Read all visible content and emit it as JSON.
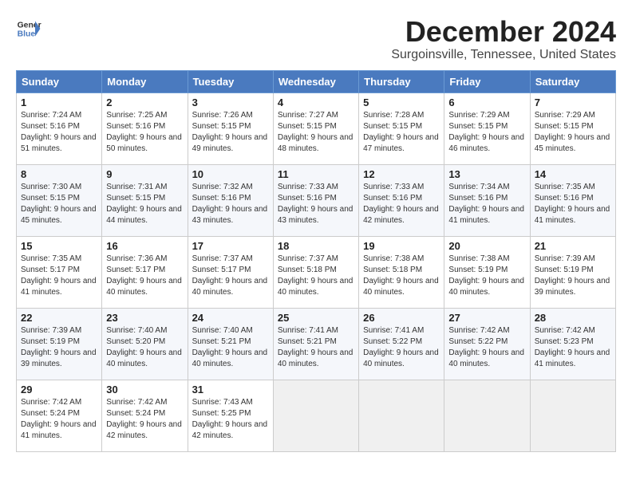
{
  "header": {
    "logo_line1": "General",
    "logo_line2": "Blue",
    "month": "December 2024",
    "location": "Surgoinsville, Tennessee, United States"
  },
  "weekdays": [
    "Sunday",
    "Monday",
    "Tuesday",
    "Wednesday",
    "Thursday",
    "Friday",
    "Saturday"
  ],
  "weeks": [
    [
      {
        "day": "1",
        "sunrise": "Sunrise: 7:24 AM",
        "sunset": "Sunset: 5:16 PM",
        "daylight": "Daylight: 9 hours and 51 minutes."
      },
      {
        "day": "2",
        "sunrise": "Sunrise: 7:25 AM",
        "sunset": "Sunset: 5:16 PM",
        "daylight": "Daylight: 9 hours and 50 minutes."
      },
      {
        "day": "3",
        "sunrise": "Sunrise: 7:26 AM",
        "sunset": "Sunset: 5:15 PM",
        "daylight": "Daylight: 9 hours and 49 minutes."
      },
      {
        "day": "4",
        "sunrise": "Sunrise: 7:27 AM",
        "sunset": "Sunset: 5:15 PM",
        "daylight": "Daylight: 9 hours and 48 minutes."
      },
      {
        "day": "5",
        "sunrise": "Sunrise: 7:28 AM",
        "sunset": "Sunset: 5:15 PM",
        "daylight": "Daylight: 9 hours and 47 minutes."
      },
      {
        "day": "6",
        "sunrise": "Sunrise: 7:29 AM",
        "sunset": "Sunset: 5:15 PM",
        "daylight": "Daylight: 9 hours and 46 minutes."
      },
      {
        "day": "7",
        "sunrise": "Sunrise: 7:29 AM",
        "sunset": "Sunset: 5:15 PM",
        "daylight": "Daylight: 9 hours and 45 minutes."
      }
    ],
    [
      {
        "day": "8",
        "sunrise": "Sunrise: 7:30 AM",
        "sunset": "Sunset: 5:15 PM",
        "daylight": "Daylight: 9 hours and 45 minutes."
      },
      {
        "day": "9",
        "sunrise": "Sunrise: 7:31 AM",
        "sunset": "Sunset: 5:15 PM",
        "daylight": "Daylight: 9 hours and 44 minutes."
      },
      {
        "day": "10",
        "sunrise": "Sunrise: 7:32 AM",
        "sunset": "Sunset: 5:16 PM",
        "daylight": "Daylight: 9 hours and 43 minutes."
      },
      {
        "day": "11",
        "sunrise": "Sunrise: 7:33 AM",
        "sunset": "Sunset: 5:16 PM",
        "daylight": "Daylight: 9 hours and 43 minutes."
      },
      {
        "day": "12",
        "sunrise": "Sunrise: 7:33 AM",
        "sunset": "Sunset: 5:16 PM",
        "daylight": "Daylight: 9 hours and 42 minutes."
      },
      {
        "day": "13",
        "sunrise": "Sunrise: 7:34 AM",
        "sunset": "Sunset: 5:16 PM",
        "daylight": "Daylight: 9 hours and 41 minutes."
      },
      {
        "day": "14",
        "sunrise": "Sunrise: 7:35 AM",
        "sunset": "Sunset: 5:16 PM",
        "daylight": "Daylight: 9 hours and 41 minutes."
      }
    ],
    [
      {
        "day": "15",
        "sunrise": "Sunrise: 7:35 AM",
        "sunset": "Sunset: 5:17 PM",
        "daylight": "Daylight: 9 hours and 41 minutes."
      },
      {
        "day": "16",
        "sunrise": "Sunrise: 7:36 AM",
        "sunset": "Sunset: 5:17 PM",
        "daylight": "Daylight: 9 hours and 40 minutes."
      },
      {
        "day": "17",
        "sunrise": "Sunrise: 7:37 AM",
        "sunset": "Sunset: 5:17 PM",
        "daylight": "Daylight: 9 hours and 40 minutes."
      },
      {
        "day": "18",
        "sunrise": "Sunrise: 7:37 AM",
        "sunset": "Sunset: 5:18 PM",
        "daylight": "Daylight: 9 hours and 40 minutes."
      },
      {
        "day": "19",
        "sunrise": "Sunrise: 7:38 AM",
        "sunset": "Sunset: 5:18 PM",
        "daylight": "Daylight: 9 hours and 40 minutes."
      },
      {
        "day": "20",
        "sunrise": "Sunrise: 7:38 AM",
        "sunset": "Sunset: 5:19 PM",
        "daylight": "Daylight: 9 hours and 40 minutes."
      },
      {
        "day": "21",
        "sunrise": "Sunrise: 7:39 AM",
        "sunset": "Sunset: 5:19 PM",
        "daylight": "Daylight: 9 hours and 39 minutes."
      }
    ],
    [
      {
        "day": "22",
        "sunrise": "Sunrise: 7:39 AM",
        "sunset": "Sunset: 5:19 PM",
        "daylight": "Daylight: 9 hours and 39 minutes."
      },
      {
        "day": "23",
        "sunrise": "Sunrise: 7:40 AM",
        "sunset": "Sunset: 5:20 PM",
        "daylight": "Daylight: 9 hours and 40 minutes."
      },
      {
        "day": "24",
        "sunrise": "Sunrise: 7:40 AM",
        "sunset": "Sunset: 5:21 PM",
        "daylight": "Daylight: 9 hours and 40 minutes."
      },
      {
        "day": "25",
        "sunrise": "Sunrise: 7:41 AM",
        "sunset": "Sunset: 5:21 PM",
        "daylight": "Daylight: 9 hours and 40 minutes."
      },
      {
        "day": "26",
        "sunrise": "Sunrise: 7:41 AM",
        "sunset": "Sunset: 5:22 PM",
        "daylight": "Daylight: 9 hours and 40 minutes."
      },
      {
        "day": "27",
        "sunrise": "Sunrise: 7:42 AM",
        "sunset": "Sunset: 5:22 PM",
        "daylight": "Daylight: 9 hours and 40 minutes."
      },
      {
        "day": "28",
        "sunrise": "Sunrise: 7:42 AM",
        "sunset": "Sunset: 5:23 PM",
        "daylight": "Daylight: 9 hours and 41 minutes."
      }
    ],
    [
      {
        "day": "29",
        "sunrise": "Sunrise: 7:42 AM",
        "sunset": "Sunset: 5:24 PM",
        "daylight": "Daylight: 9 hours and 41 minutes."
      },
      {
        "day": "30",
        "sunrise": "Sunrise: 7:42 AM",
        "sunset": "Sunset: 5:24 PM",
        "daylight": "Daylight: 9 hours and 42 minutes."
      },
      {
        "day": "31",
        "sunrise": "Sunrise: 7:43 AM",
        "sunset": "Sunset: 5:25 PM",
        "daylight": "Daylight: 9 hours and 42 minutes."
      },
      null,
      null,
      null,
      null
    ]
  ]
}
